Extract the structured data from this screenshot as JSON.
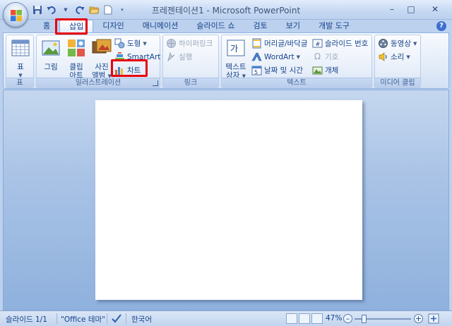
{
  "window": {
    "title": "프레젠테이션1 - Microsoft PowerPoint",
    "controls": {
      "minimize": "–",
      "maximize": "□",
      "close": "✕"
    }
  },
  "qat": {
    "more": "▾"
  },
  "tabs": [
    {
      "label": "홈"
    },
    {
      "label": "삽입",
      "active": true
    },
    {
      "label": "디자인"
    },
    {
      "label": "애니메이션"
    },
    {
      "label": "슬라이드 쇼"
    },
    {
      "label": "검토"
    },
    {
      "label": "보기"
    },
    {
      "label": "개발 도구"
    }
  ],
  "help": "?",
  "ribbon": {
    "groups": {
      "table": {
        "label": "표",
        "table_button": "표"
      },
      "illustrations": {
        "label": "일러스트레이션",
        "picture": "그림",
        "clipart_line1": "클립",
        "clipart_line2": "아트",
        "photo_line1": "사진",
        "photo_line2": "앨범",
        "shapes": "도형",
        "smartart": "SmartArt",
        "chart": "차트"
      },
      "links": {
        "label": "링크",
        "hyperlink": "하이퍼링크",
        "action": "실행"
      },
      "text": {
        "label": "텍스트",
        "textbox_line1": "텍스트",
        "textbox_line2": "상자",
        "header_footer": "머리글/바닥글",
        "wordart": "WordArt",
        "datetime": "날짜 및 시간",
        "slide_number": "슬라이드 번호",
        "symbol": "기호",
        "object": "개체"
      },
      "media": {
        "label": "미디어 클립",
        "movie": "동영상",
        "sound": "소리"
      }
    }
  },
  "statusbar": {
    "slide": "슬라이드 1/1",
    "theme": "\"Office 테마\"",
    "language": "한국어",
    "zoom": "47%",
    "zoom_out": "–",
    "zoom_in": "+"
  },
  "colors": {
    "highlight": "#e8000a",
    "accent": "#15428b"
  }
}
